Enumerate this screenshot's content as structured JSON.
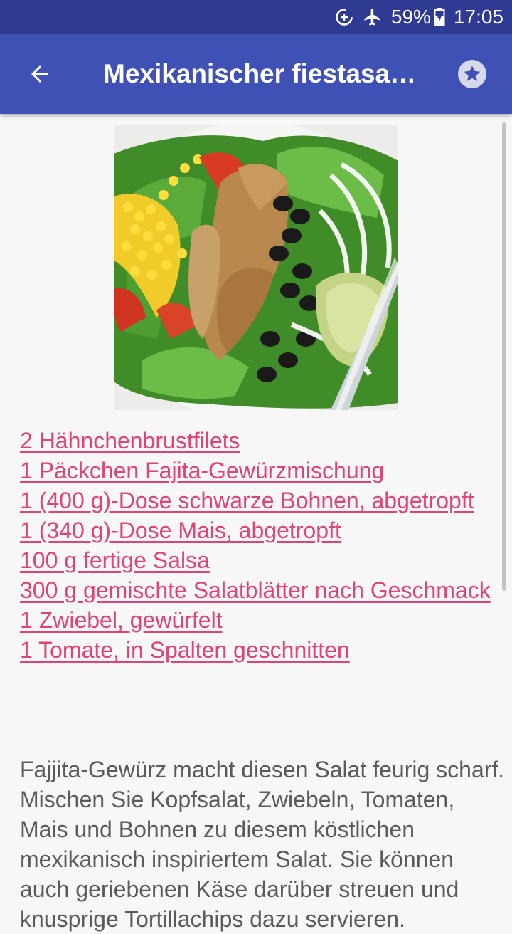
{
  "status_bar": {
    "battery": "59%",
    "time": "17:05",
    "icons": [
      "data-saver-icon",
      "airplane-mode-icon",
      "battery-charging-icon"
    ]
  },
  "app_bar": {
    "title": "Mexikanischer fiestasa…",
    "back_icon": "arrow-back-icon",
    "favorite_icon": "star-icon"
  },
  "recipe": {
    "image_alt": "salad-photo",
    "ingredients": [
      "2 Hähnchenbrustfilets",
      "1 Päckchen Fajita-Gewürzmischung",
      "1 (400 g)-Dose schwarze Bohnen, abgetropft",
      "1 (340 g)-Dose Mais, abgetropft",
      "100 g fertige Salsa",
      "300 g gemischte Salatblätter nach Geschmack",
      "1 Zwiebel, gewürfelt",
      "1 Tomate, in Spalten geschnitten"
    ],
    "description": "Fajjita-Gewürz macht diesen Salat feurig scharf. Mischen Sie Kopfsalat, Zwiebeln, Tomaten, Mais und Bohnen zu diesem köstlichen mexikanisch inspiriertem Salat. Sie können auch geriebenen Käse darüber streuen und knusprige Tortillachips dazu servieren."
  },
  "colors": {
    "status_bar": "#2f3b93",
    "app_bar": "#3f51b5",
    "link": "#e0427a",
    "body_text": "#5a5a5a",
    "background": "#f7f7f7"
  }
}
